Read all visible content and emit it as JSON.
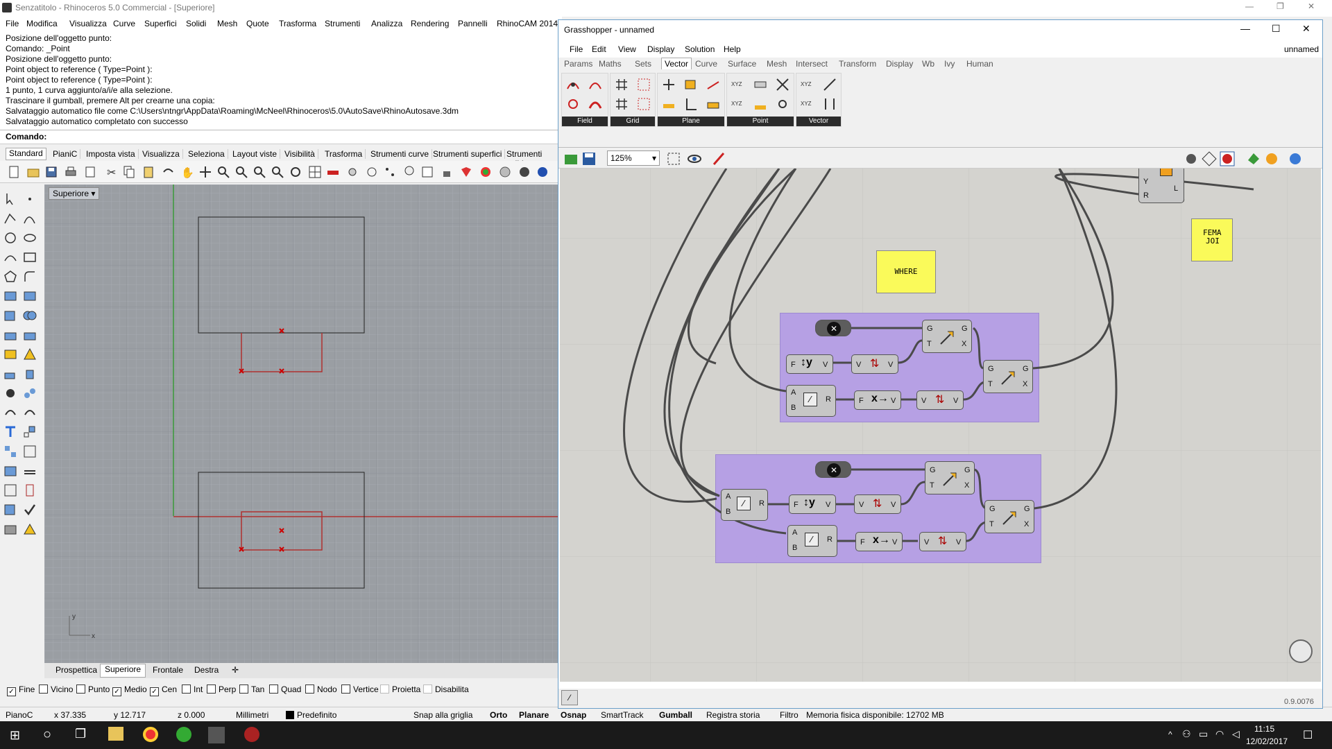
{
  "rhino": {
    "title": "Senzatitolo - Rhinoceros 5.0 Commercial - [Superiore]",
    "menu": [
      "File",
      "Modifica",
      "Visualizza",
      "Curve",
      "Superfici",
      "Solidi",
      "Mesh",
      "Quote",
      "Trasforma",
      "Strumenti",
      "Analizza",
      "Rendering",
      "Pannelli",
      "RhinoCAM 2014"
    ],
    "history": [
      "Posizione dell'oggetto punto:",
      "Comando: _Point",
      "Posizione dell'oggetto punto:",
      "Point object to reference ( Type=Point ):",
      "Point object to reference ( Type=Point ):",
      "1 punto, 1 curva aggiunto/a/i/e alla selezione.",
      "Trascinare il gumball, premere Alt per crearne una copia:",
      "Salvataggio automatico file come C:\\Users\\ntngr\\AppData\\Roaming\\McNeel\\Rhinoceros\\5.0\\AutoSave\\RhinoAutosave.3dm",
      "Salvataggio automatico completato con successo"
    ],
    "command_prompt": "Comando:",
    "toolbar_tabs": [
      "Standard",
      "PianiC",
      "Imposta vista",
      "Visualizza",
      "Seleziona",
      "Layout viste",
      "Visibilità",
      "Trasforma",
      "Strumenti curve",
      "Strumenti superfici",
      "Strumenti solid"
    ],
    "viewport_label": "Superiore",
    "viewport_tabs": [
      "Prospettica",
      "Superiore",
      "Frontale",
      "Destra"
    ],
    "osnaps": [
      {
        "label": "Fine",
        "checked": true
      },
      {
        "label": "Vicino",
        "checked": false
      },
      {
        "label": "Punto",
        "checked": false
      },
      {
        "label": "Medio",
        "checked": true
      },
      {
        "label": "Cen",
        "checked": true
      },
      {
        "label": "Int",
        "checked": false
      },
      {
        "label": "Perp",
        "checked": false
      },
      {
        "label": "Tan",
        "checked": false
      },
      {
        "label": "Quad",
        "checked": false
      },
      {
        "label": "Nodo",
        "checked": false
      },
      {
        "label": "Vertice",
        "checked": false
      },
      {
        "label": "Proietta",
        "checked": false
      },
      {
        "label": "Disabilita",
        "checked": false
      }
    ],
    "status": {
      "cplane": "PianoC",
      "x": "x 37.335",
      "y": "y 12.717",
      "z": "z 0.000",
      "units": "Millimetri",
      "layer": "Predefinito",
      "grid_snap": "Snap alla griglia",
      "ortho": "Orto",
      "planar": "Planare",
      "osnap": "Osnap",
      "smarttrack": "SmartTrack",
      "gumball": "Gumball",
      "history": "Registra storia",
      "filter": "Filtro",
      "memory": "Memoria fisica disponibile: 12702 MB"
    }
  },
  "gh": {
    "title": "Grasshopper - unnamed",
    "doc_name": "unnamed",
    "menu": [
      "File",
      "Edit",
      "View",
      "Display",
      "Solution",
      "Help"
    ],
    "tabs": [
      "Params",
      "Maths",
      "Sets",
      "Vector",
      "Curve",
      "Surface",
      "Mesh",
      "Intersect",
      "Transform",
      "Display",
      "Wb",
      "Ivy",
      "Human"
    ],
    "active_tab": "Vector",
    "groups": [
      "Field",
      "Grid",
      "Plane",
      "Point",
      "Vector"
    ],
    "zoom": "125%",
    "version": "0.9.0076",
    "canvas": {
      "where_label": "WHERE",
      "female_label_1": "FEMA",
      "female_label_2": "JOI",
      "param_labels": {
        "g": "G",
        "t": "T",
        "x": "X",
        "f": "F",
        "v": "V",
        "a": "A",
        "b": "B",
        "r": "R",
        "y": "Y",
        "l": "L"
      }
    }
  },
  "taskbar": {
    "time": "11:15",
    "date": "12/02/2017"
  }
}
